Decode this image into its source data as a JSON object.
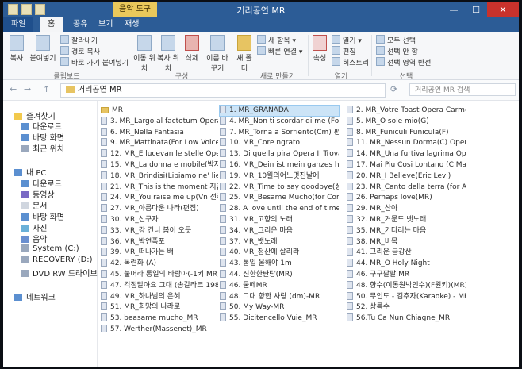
{
  "window": {
    "title": "거리공연 MR",
    "context_tab": "음악 도구",
    "controls": {
      "minimize": "—",
      "maximize": "☐",
      "close": "✕"
    }
  },
  "tabs": [
    "파일",
    "홈",
    "공유",
    "보기",
    "재생"
  ],
  "ribbon": {
    "clipboard": {
      "copy": "복사",
      "paste": "붙여넣기",
      "cut": "잘라내기",
      "copy_path": "경로 복사",
      "paste_shortcut": "바로 가기 붙여넣기",
      "group": "클립보드"
    },
    "organize": {
      "move_to": "이동 위치",
      "copy_to": "복사 위치",
      "delete": "삭제",
      "rename": "이름 바꾸기",
      "group": "구성"
    },
    "new": {
      "new_folder": "새 폴더",
      "new_item": "새 항목 ▾",
      "easy_access": "빠른 연결 ▾",
      "group": "새로 만들기"
    },
    "open": {
      "properties": "속성",
      "open": "열기 ▾",
      "edit": "편집",
      "history": "히스토리",
      "group": "열기"
    },
    "select": {
      "select_all": "모두 선택",
      "select_none": "선택 안 함",
      "invert": "선택 영역 반전",
      "group": "선택"
    }
  },
  "address": {
    "path": "거리공연 MR",
    "search_placeholder": "거리공연 MR 검색",
    "back": "←",
    "forward": "→",
    "up": "↑",
    "refresh": "⟳"
  },
  "nav_pane": {
    "favorites": "즐겨찾기",
    "fav_items": [
      "다운로드",
      "바탕 화면",
      "최근 위치"
    ],
    "this_pc": "내 PC",
    "pc_items": [
      "다운로드",
      "동영상",
      "문서",
      "바탕 화면",
      "사진",
      "음악",
      "System (C:)",
      "RECOVERY (D:)",
      "DVD RW 드라이브 (E:)"
    ],
    "network": "네트워크"
  },
  "files": {
    "selected": "1. MR_GRANADA",
    "col1": [
      "MR",
      "3. MR_Largo al factotum Opera Il B...",
      "6. MR_Nella Fantasia",
      "9. MR_Mattinata(For Low Voice)",
      "12. MR_E lucevan le stelle Opera To...",
      "15. MR_La donna e mobile(박자수...",
      "18. MR_Brindisi(Libiamo ne' lieti cal...",
      "21. MR_This is the moment 지금 이...",
      "24. MR_You raise me up(Vn 전주 ...",
      "27. MR_아름다운 나라(편집)",
      "30. MR_선구자",
      "33. MR_강 건너 봄이 오듯",
      "36. MR_박연폭포",
      "39. MR_떠나가는 배",
      "42. 목련화 (A)",
      "45. 불어라 통일의 바람아(-1키 MR)",
      "47. 걱정말아요 그대 (송칼라크 198...",
      "49. MR_하나님의 은혜",
      "51. MR_희망의 나라로",
      "53. beasame mucho_MR",
      "57. Werther(Massenet)_MR"
    ],
    "col2": [
      "1. MR_GRANADA",
      "4. MR_Non ti scordar di me (For Te...",
      "7. MR_Torna a Sorriento(Cm) 편집...",
      "10. MR_Core ngrato",
      "13. Di quella pira Opera Il Trovatore...",
      "16. MR_Dein ist mein ganzes herz",
      "19. MR_10월의어느멋진날에",
      "22. MR_Time to say goodbye(성여울)",
      "25. MR_Besame Mucho(for Come B...",
      "28. A love until the end of time(MR...",
      "31. MR_고향의 노래",
      "34. MR_그리운 마음",
      "37. MR_뱃노래",
      "40. MR_청산에 살리라",
      "43. 통일 울해야 1m",
      "44. 진한한탄탕(MR)",
      "46. 물떼MR",
      "48. 그대 향한 사랑 (dm)-MR",
      "50. My Way-MR",
      "55. Dicitencello Vuie_MR"
    ],
    "col3": [
      "2. MR_Votre Toast Opera Carmen ...",
      "5. MR_O sole mio(G)",
      "8. MR_Funiculi Funicula(F)",
      "11. MR_Nessun Dorma(C) Opera Tu...",
      "14. MR_Una furtiva lagrima Opera E...",
      "17. Mai Piu Cosi Lontano (C Major ...",
      "20. MR_I Believe(Eric Levi)",
      "23. MR_Canto della terra (for Andre...",
      "26. Perhaps love(MR)",
      "29. MR_산아",
      "32. MR_거문도 뱃노래",
      "35. MR_기다리는 마음",
      "38. MR_비목",
      "41. 그리운 금강산",
      "44. MR_O Holy Night",
      "46. 구구팔팔 MR",
      "48. 향수(이동원박인수)(F원키)(MR)",
      "50. 무인도 - 김추자(Karaoke) - MR",
      "52. 상록수",
      "56.Tu Ca Nun Chiagne_MR"
    ]
  }
}
